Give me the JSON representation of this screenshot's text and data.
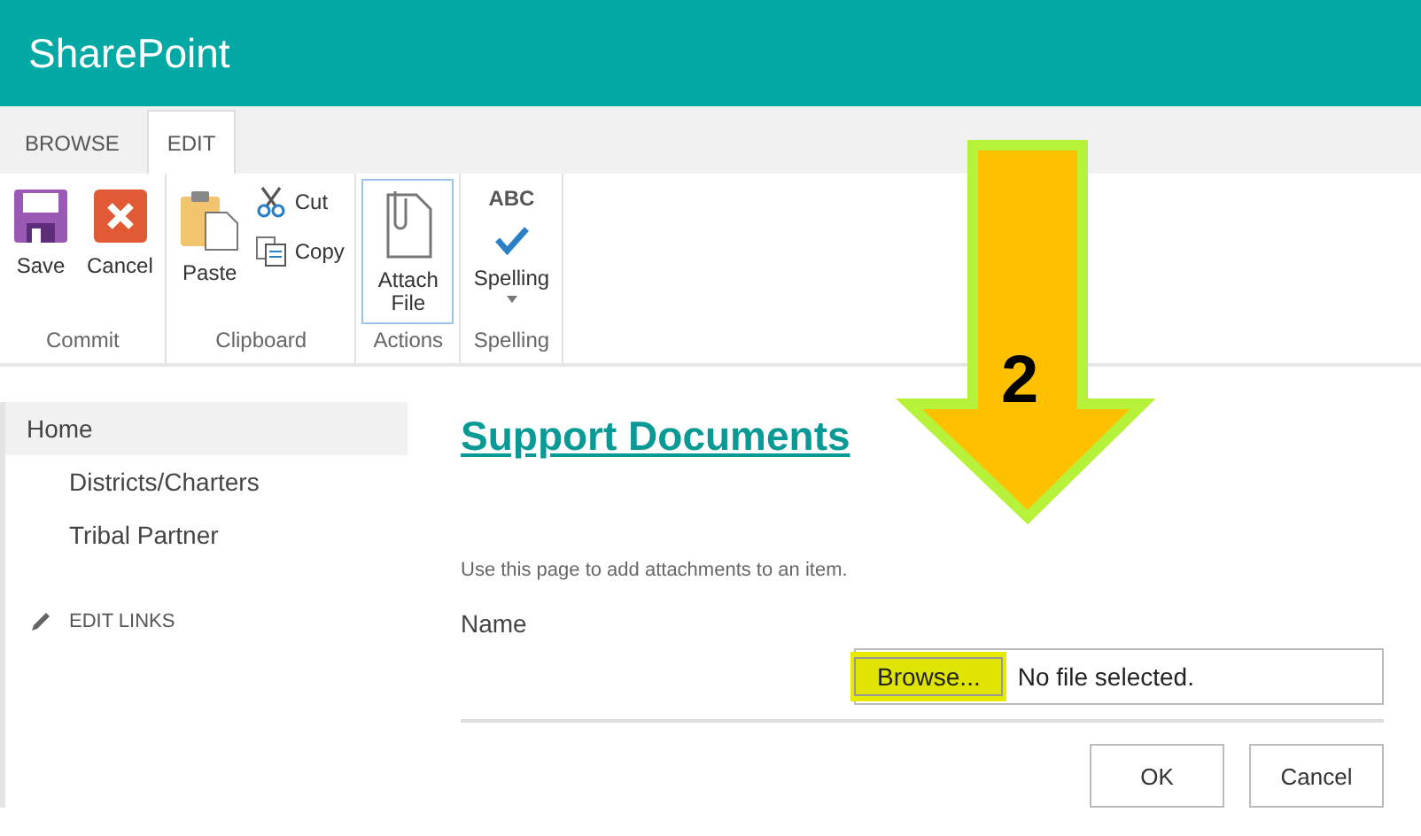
{
  "app": {
    "title": "SharePoint"
  },
  "tabs": [
    {
      "label": "BROWSE",
      "selected": false
    },
    {
      "label": "EDIT",
      "selected": true
    }
  ],
  "ribbon_groups": [
    {
      "label": "Commit",
      "buttons": [
        {
          "label": "Save",
          "kind": "save",
          "selected": false
        },
        {
          "label": "Cancel",
          "kind": "cancel",
          "selected": false
        }
      ]
    },
    {
      "label": "Clipboard",
      "buttons": [
        {
          "label": "Paste",
          "kind": "paste",
          "selected": false
        },
        {
          "label": "Cut",
          "kind": "cut",
          "selected": false
        },
        {
          "label": "Copy",
          "kind": "copy",
          "selected": false
        }
      ]
    },
    {
      "label": "Actions",
      "buttons": [
        {
          "label": "Attach File",
          "kind": "attach",
          "selected": true
        }
      ]
    },
    {
      "label": "Spelling",
      "buttons": [
        {
          "label": "Spelling",
          "kind": "spelling",
          "selected": false,
          "icon_text": "ABC"
        }
      ]
    }
  ],
  "sidebar": {
    "items": [
      {
        "label": "Home",
        "selected": true,
        "children": [
          {
            "label": "Districts/Charters",
            "selected": false
          },
          {
            "label": "Tribal Partner",
            "selected": false
          }
        ]
      }
    ],
    "edit_links": "EDIT LINKS"
  },
  "page": {
    "title": "Support Documents",
    "description": "Use this page to add attachments to an item.",
    "field_label": "Name",
    "file_input": {
      "button": "Browse...",
      "value": "No file selected.",
      "highlighted": true
    },
    "buttons": [
      "OK",
      "Cancel"
    ]
  },
  "annotation": {
    "label": "2"
  }
}
